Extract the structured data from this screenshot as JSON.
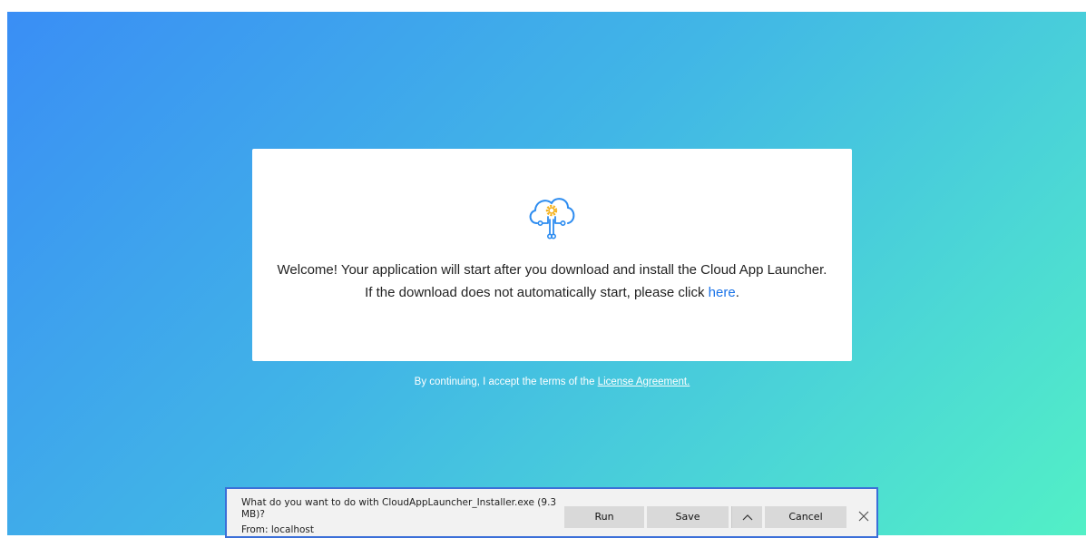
{
  "colors": {
    "gradient_start": "#3a8ef5",
    "gradient_end": "#52f0c6",
    "link": "#1a73e8",
    "logo_blue": "#2d8cf0",
    "logo_gear": "#f5b321"
  },
  "card": {
    "logo_icon": "cloud-circuit-gear-icon",
    "welcome_text": "Welcome! Your application will start after you download and install the Cloud App Launcher.",
    "download_prefix": "If the download does not automatically start, please click ",
    "download_link": "here",
    "download_suffix": "."
  },
  "terms": {
    "prefix": "By continuing, I accept the terms of the ",
    "link": "License Agreement."
  },
  "download_bar": {
    "question": "What do you want to do with CloudAppLauncher_Installer.exe (9.3 MB)?",
    "from": "From: localhost",
    "run_label": "Run",
    "save_label": "Save",
    "cancel_label": "Cancel",
    "arrow_icon": "chevron-up-icon",
    "close_icon": "close-icon"
  }
}
